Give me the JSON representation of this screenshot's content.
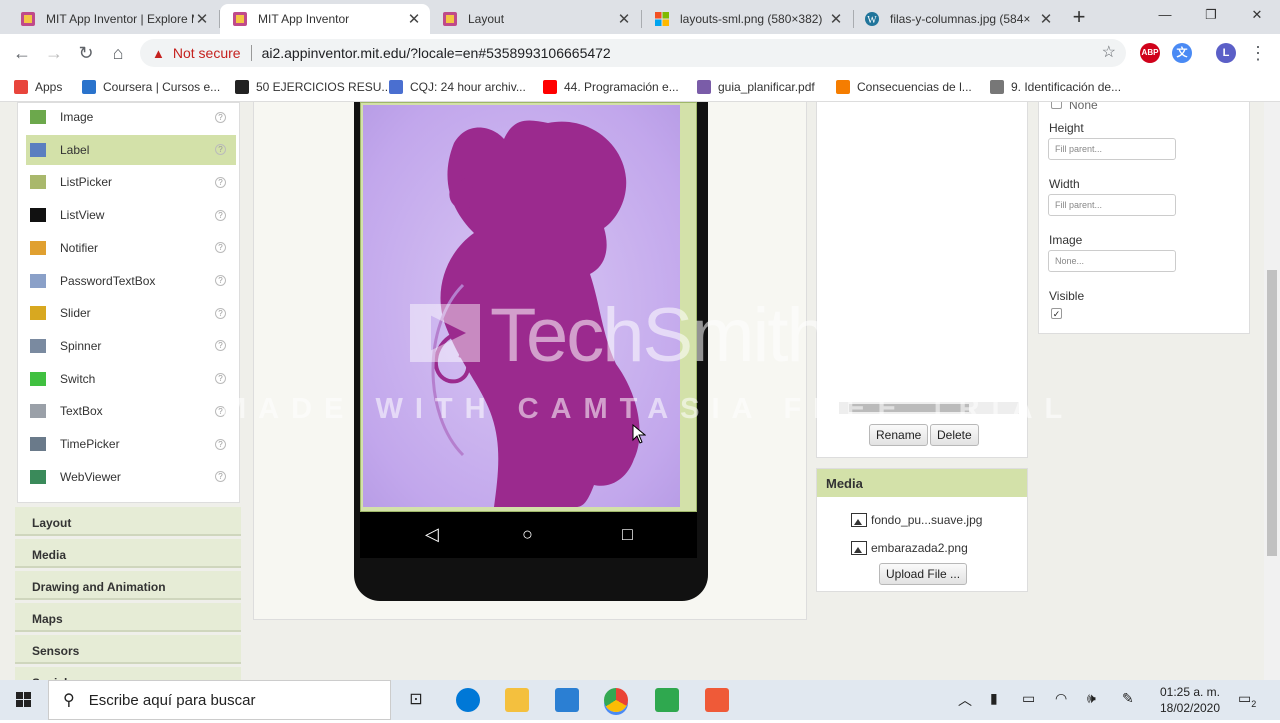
{
  "tabs": [
    {
      "title": "MIT App Inventor | Explore MIT App Inventor",
      "active": false
    },
    {
      "title": "MIT App Inventor",
      "active": true
    },
    {
      "title": "Layout",
      "active": false
    },
    {
      "title": "layouts-sml.png (580×382)",
      "active": false
    },
    {
      "title": "filas-y-columnas.jpg (584×",
      "active": false
    }
  ],
  "window": {
    "new_tab": "+",
    "minimize": "—",
    "maximize": "❐",
    "close": "✕"
  },
  "address": {
    "warning": "Not secure",
    "url": "ai2.appinventor.mit.edu/?locale=en#5358993106665472",
    "abp": "ABP",
    "avatar": "L"
  },
  "bookmarks": [
    {
      "label": "Apps",
      "color": "#e8453c"
    },
    {
      "label": "Coursera | Cursos e...",
      "color": "#2a73cc"
    },
    {
      "label": "50 EJERCICIOS RESU...",
      "color": "#222222"
    },
    {
      "label": "CQJ: 24 hour archiv...",
      "color": "#4a6fd0"
    },
    {
      "label": "44. Programación e...",
      "color": "#ff0000"
    },
    {
      "label": "guia_planificar.pdf",
      "color": "#7a5ca8"
    },
    {
      "label": "Consecuencias de l...",
      "color": "#f57d00"
    },
    {
      "label": "9. Identificación de...",
      "color": "#777777"
    }
  ],
  "palette": {
    "items": [
      {
        "label": "Image",
        "icon": "image-icon",
        "color": "#6ca84c"
      },
      {
        "label": "Label",
        "icon": "label-icon",
        "color": "#5a7fc0",
        "selected": true
      },
      {
        "label": "ListPicker",
        "icon": "listpicker-icon",
        "color": "#a9b86c"
      },
      {
        "label": "ListView",
        "icon": "listview-icon",
        "color": "#111111"
      },
      {
        "label": "Notifier",
        "icon": "notifier-icon",
        "color": "#e0a030"
      },
      {
        "label": "PasswordTextBox",
        "icon": "password-icon",
        "color": "#8aa0c8"
      },
      {
        "label": "Slider",
        "icon": "slider-icon",
        "color": "#d8a820"
      },
      {
        "label": "Spinner",
        "icon": "spinner-icon",
        "color": "#7a8aa0"
      },
      {
        "label": "Switch",
        "icon": "switch-icon",
        "color": "#40c040"
      },
      {
        "label": "TextBox",
        "icon": "textbox-icon",
        "color": "#9aa0a8"
      },
      {
        "label": "TimePicker",
        "icon": "timepicker-icon",
        "color": "#6a7a8a"
      },
      {
        "label": "WebViewer",
        "icon": "webviewer-icon",
        "color": "#3a8a5a"
      }
    ],
    "help": "?",
    "categories": [
      "Layout",
      "Media",
      "Drawing and Animation",
      "Maps",
      "Sensors",
      "Social"
    ]
  },
  "components": {
    "rename": "Rename",
    "delete": "Delete"
  },
  "media": {
    "title": "Media",
    "files": [
      "fondo_pu...suave.jpg",
      "embarazada2.png"
    ],
    "upload": "Upload File ..."
  },
  "properties": {
    "none_label": "None",
    "height_label": "Height",
    "height_value": "Fill parent...",
    "width_label": "Width",
    "width_value": "Fill parent...",
    "image_label": "Image",
    "image_value": "None...",
    "visible_label": "Visible",
    "visible_checked": "✓"
  },
  "watermark": {
    "brand": "TechSmith",
    "registered": "®",
    "trial": "MADE WITH CAMTASIA FREE TRIAL"
  },
  "taskbar": {
    "search_placeholder": "Escribe aquí para buscar",
    "time": "01:25 a. m.",
    "date": "18/02/2020",
    "notifications": "2"
  }
}
